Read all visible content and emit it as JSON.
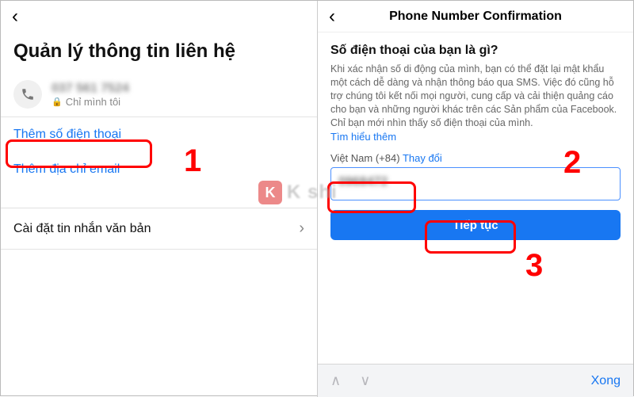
{
  "left": {
    "title": "Quản lý thông tin liên hệ",
    "phone_masked": "037 561 7524",
    "privacy_label": "Chỉ mình tôi",
    "add_phone": "Thêm số điện thoại",
    "add_email": "Thêm địa chỉ email",
    "text_settings": "Cài đặt tin nhắn văn bản"
  },
  "right": {
    "header": "Phone Number Confirmation",
    "question": "Số điện thoại của bạn là gì?",
    "desc": "Khi xác nhận số di động của mình, bạn có thể đặt lại mật khẩu một cách dễ dàng và nhận thông báo qua SMS. Việc đó cũng hỗ trợ chúng tôi kết nối mọi người, cung cấp và cải thiện quảng cáo cho bạn và những người khác trên các Sản phẩm của Facebook. Chỉ bạn mới nhìn thấy số điện thoại của mình.",
    "learn_more": "Tìm hiểu thêm",
    "country": "Việt Nam (+84)",
    "change": "Thay đổi",
    "input_value": "0968472",
    "continue": "Tiếp tục",
    "done": "Xong"
  },
  "annotations": {
    "n1": "1",
    "n2": "2",
    "n3": "3"
  },
  "watermark": {
    "badge": "K",
    "text": "K shi"
  }
}
